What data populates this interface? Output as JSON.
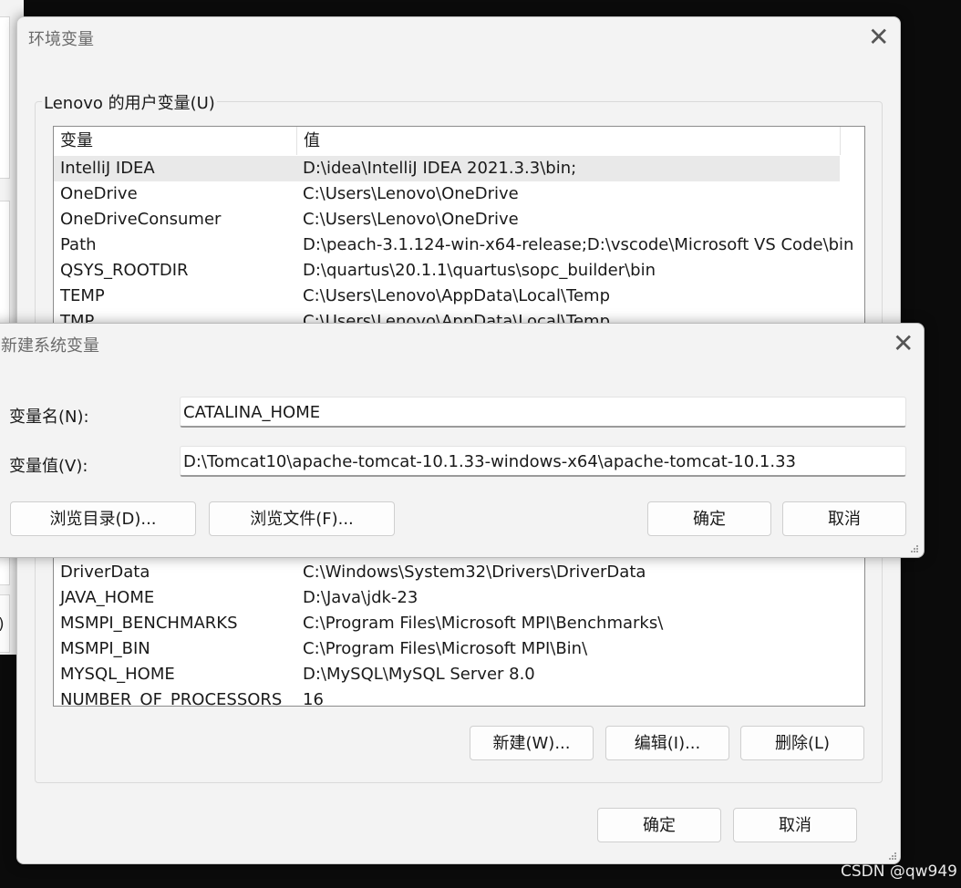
{
  "background_window": {
    "partial_text": ")"
  },
  "env_dialog": {
    "title": "环境变量",
    "close_glyph": "✕",
    "user_vars": {
      "label": "Lenovo 的用户变量(U)",
      "col_name": "变量",
      "col_value": "值",
      "rows": [
        {
          "name": "IntelliJ IDEA",
          "value": "D:\\idea\\IntelliJ IDEA 2021.3.3\\bin;"
        },
        {
          "name": "OneDrive",
          "value": "C:\\Users\\Lenovo\\OneDrive"
        },
        {
          "name": "OneDriveConsumer",
          "value": "C:\\Users\\Lenovo\\OneDrive"
        },
        {
          "name": "Path",
          "value": "D:\\peach-3.1.124-win-x64-release;D:\\vscode\\Microsoft VS Code\\bin"
        },
        {
          "name": "QSYS_ROOTDIR",
          "value": "D:\\quartus\\20.1.1\\quartus\\sopc_builder\\bin"
        },
        {
          "name": "TEMP",
          "value": "C:\\Users\\Lenovo\\AppData\\Local\\Temp"
        },
        {
          "name": "TMP",
          "value": "C:\\Users\\Lenovo\\AppData\\Local\\Temp"
        }
      ]
    },
    "system_vars": {
      "rows": [
        {
          "name": "DriverData",
          "value": "C:\\Windows\\System32\\Drivers\\DriverData"
        },
        {
          "name": "JAVA_HOME",
          "value": "D:\\Java\\jdk-23"
        },
        {
          "name": "MSMPI_BENCHMARKS",
          "value": "C:\\Program Files\\Microsoft MPI\\Benchmarks\\"
        },
        {
          "name": "MSMPI_BIN",
          "value": "C:\\Program Files\\Microsoft MPI\\Bin\\"
        },
        {
          "name": "MYSQL_HOME",
          "value": "D:\\MySQL\\MySQL Server 8.0"
        },
        {
          "name": "NUMBER_OF_PROCESSORS",
          "value": "16"
        }
      ],
      "new_label": "新建(W)...",
      "edit_label": "编辑(I)...",
      "delete_label": "删除(L)"
    },
    "ok_label": "确定",
    "cancel_label": "取消"
  },
  "new_dialog": {
    "title": "新建系统变量",
    "close_glyph": "✕",
    "name_label": "变量名(N):",
    "name_value": "CATALINA_HOME",
    "value_label": "变量值(V):",
    "value_value": "D:\\Tomcat10\\apache-tomcat-10.1.33-windows-x64\\apache-tomcat-10.1.33",
    "browse_dir_label": "浏览目录(D)...",
    "browse_file_label": "浏览文件(F)...",
    "ok_label": "确定",
    "cancel_label": "取消"
  },
  "watermark": "CSDN @qw949"
}
